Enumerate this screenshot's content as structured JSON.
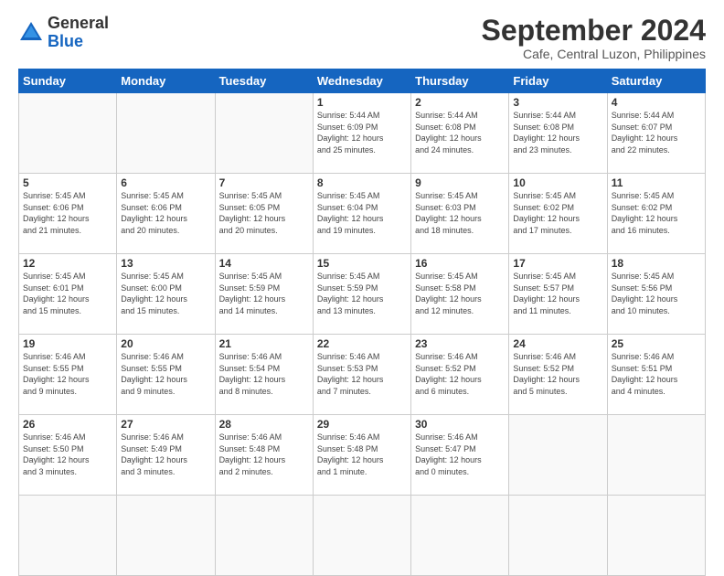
{
  "logo": {
    "general": "General",
    "blue": "Blue"
  },
  "header": {
    "month": "September 2024",
    "location": "Cafe, Central Luzon, Philippines"
  },
  "weekdays": [
    "Sunday",
    "Monday",
    "Tuesday",
    "Wednesday",
    "Thursday",
    "Friday",
    "Saturday"
  ],
  "days": [
    {
      "day": "",
      "info": ""
    },
    {
      "day": "",
      "info": ""
    },
    {
      "day": "",
      "info": ""
    },
    {
      "day": "1",
      "info": "Sunrise: 5:44 AM\nSunset: 6:09 PM\nDaylight: 12 hours\nand 25 minutes."
    },
    {
      "day": "2",
      "info": "Sunrise: 5:44 AM\nSunset: 6:08 PM\nDaylight: 12 hours\nand 24 minutes."
    },
    {
      "day": "3",
      "info": "Sunrise: 5:44 AM\nSunset: 6:08 PM\nDaylight: 12 hours\nand 23 minutes."
    },
    {
      "day": "4",
      "info": "Sunrise: 5:44 AM\nSunset: 6:07 PM\nDaylight: 12 hours\nand 22 minutes."
    },
    {
      "day": "5",
      "info": "Sunrise: 5:45 AM\nSunset: 6:06 PM\nDaylight: 12 hours\nand 21 minutes."
    },
    {
      "day": "6",
      "info": "Sunrise: 5:45 AM\nSunset: 6:06 PM\nDaylight: 12 hours\nand 20 minutes."
    },
    {
      "day": "7",
      "info": "Sunrise: 5:45 AM\nSunset: 6:05 PM\nDaylight: 12 hours\nand 20 minutes."
    },
    {
      "day": "8",
      "info": "Sunrise: 5:45 AM\nSunset: 6:04 PM\nDaylight: 12 hours\nand 19 minutes."
    },
    {
      "day": "9",
      "info": "Sunrise: 5:45 AM\nSunset: 6:03 PM\nDaylight: 12 hours\nand 18 minutes."
    },
    {
      "day": "10",
      "info": "Sunrise: 5:45 AM\nSunset: 6:02 PM\nDaylight: 12 hours\nand 17 minutes."
    },
    {
      "day": "11",
      "info": "Sunrise: 5:45 AM\nSunset: 6:02 PM\nDaylight: 12 hours\nand 16 minutes."
    },
    {
      "day": "12",
      "info": "Sunrise: 5:45 AM\nSunset: 6:01 PM\nDaylight: 12 hours\nand 15 minutes."
    },
    {
      "day": "13",
      "info": "Sunrise: 5:45 AM\nSunset: 6:00 PM\nDaylight: 12 hours\nand 15 minutes."
    },
    {
      "day": "14",
      "info": "Sunrise: 5:45 AM\nSunset: 5:59 PM\nDaylight: 12 hours\nand 14 minutes."
    },
    {
      "day": "15",
      "info": "Sunrise: 5:45 AM\nSunset: 5:59 PM\nDaylight: 12 hours\nand 13 minutes."
    },
    {
      "day": "16",
      "info": "Sunrise: 5:45 AM\nSunset: 5:58 PM\nDaylight: 12 hours\nand 12 minutes."
    },
    {
      "day": "17",
      "info": "Sunrise: 5:45 AM\nSunset: 5:57 PM\nDaylight: 12 hours\nand 11 minutes."
    },
    {
      "day": "18",
      "info": "Sunrise: 5:45 AM\nSunset: 5:56 PM\nDaylight: 12 hours\nand 10 minutes."
    },
    {
      "day": "19",
      "info": "Sunrise: 5:46 AM\nSunset: 5:55 PM\nDaylight: 12 hours\nand 9 minutes."
    },
    {
      "day": "20",
      "info": "Sunrise: 5:46 AM\nSunset: 5:55 PM\nDaylight: 12 hours\nand 9 minutes."
    },
    {
      "day": "21",
      "info": "Sunrise: 5:46 AM\nSunset: 5:54 PM\nDaylight: 12 hours\nand 8 minutes."
    },
    {
      "day": "22",
      "info": "Sunrise: 5:46 AM\nSunset: 5:53 PM\nDaylight: 12 hours\nand 7 minutes."
    },
    {
      "day": "23",
      "info": "Sunrise: 5:46 AM\nSunset: 5:52 PM\nDaylight: 12 hours\nand 6 minutes."
    },
    {
      "day": "24",
      "info": "Sunrise: 5:46 AM\nSunset: 5:52 PM\nDaylight: 12 hours\nand 5 minutes."
    },
    {
      "day": "25",
      "info": "Sunrise: 5:46 AM\nSunset: 5:51 PM\nDaylight: 12 hours\nand 4 minutes."
    },
    {
      "day": "26",
      "info": "Sunrise: 5:46 AM\nSunset: 5:50 PM\nDaylight: 12 hours\nand 3 minutes."
    },
    {
      "day": "27",
      "info": "Sunrise: 5:46 AM\nSunset: 5:49 PM\nDaylight: 12 hours\nand 3 minutes."
    },
    {
      "day": "28",
      "info": "Sunrise: 5:46 AM\nSunset: 5:48 PM\nDaylight: 12 hours\nand 2 minutes."
    },
    {
      "day": "29",
      "info": "Sunrise: 5:46 AM\nSunset: 5:48 PM\nDaylight: 12 hours\nand 1 minute."
    },
    {
      "day": "30",
      "info": "Sunrise: 5:46 AM\nSunset: 5:47 PM\nDaylight: 12 hours\nand 0 minutes."
    },
    {
      "day": "",
      "info": ""
    },
    {
      "day": "",
      "info": ""
    },
    {
      "day": "",
      "info": ""
    },
    {
      "day": "",
      "info": ""
    },
    {
      "day": "",
      "info": ""
    }
  ]
}
